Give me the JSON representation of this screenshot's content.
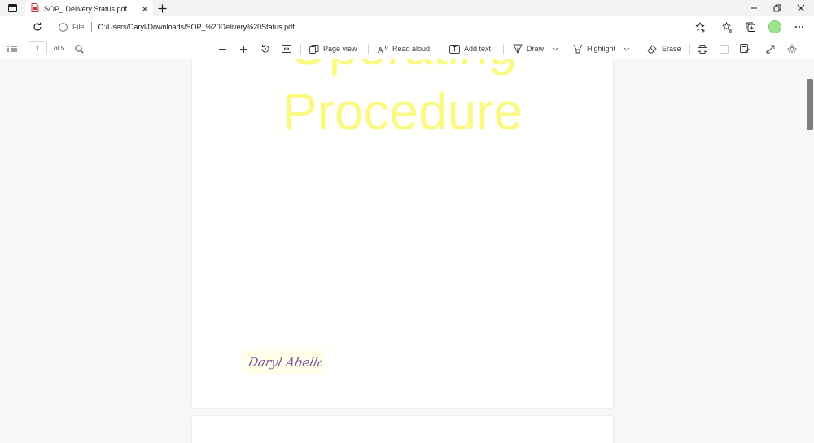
{
  "tab": {
    "title": "SOP_ Delivery Status.pdf",
    "icon": "pdf-file-icon"
  },
  "address": {
    "scheme": "File",
    "url": "C:/Users/Daryl/Downloads/SOP_%20Delivery%20Status.pdf"
  },
  "pdf_toolbar": {
    "page_number": "1",
    "page_total": "of 5",
    "page_view": "Page view",
    "read_aloud": "Read aloud",
    "add_text": "Add text",
    "draw": "Draw",
    "highlight": "Highlight",
    "erase": "Erase"
  },
  "document": {
    "title_line1": "Operating",
    "title_line2": "Procedure",
    "title_color": "#fbf982",
    "signature": "Daryl Abella",
    "signature_color": "#7a4fa0"
  },
  "colors": {
    "accent_profile": "#9fe38e",
    "pdf_icon": "#d13438"
  }
}
